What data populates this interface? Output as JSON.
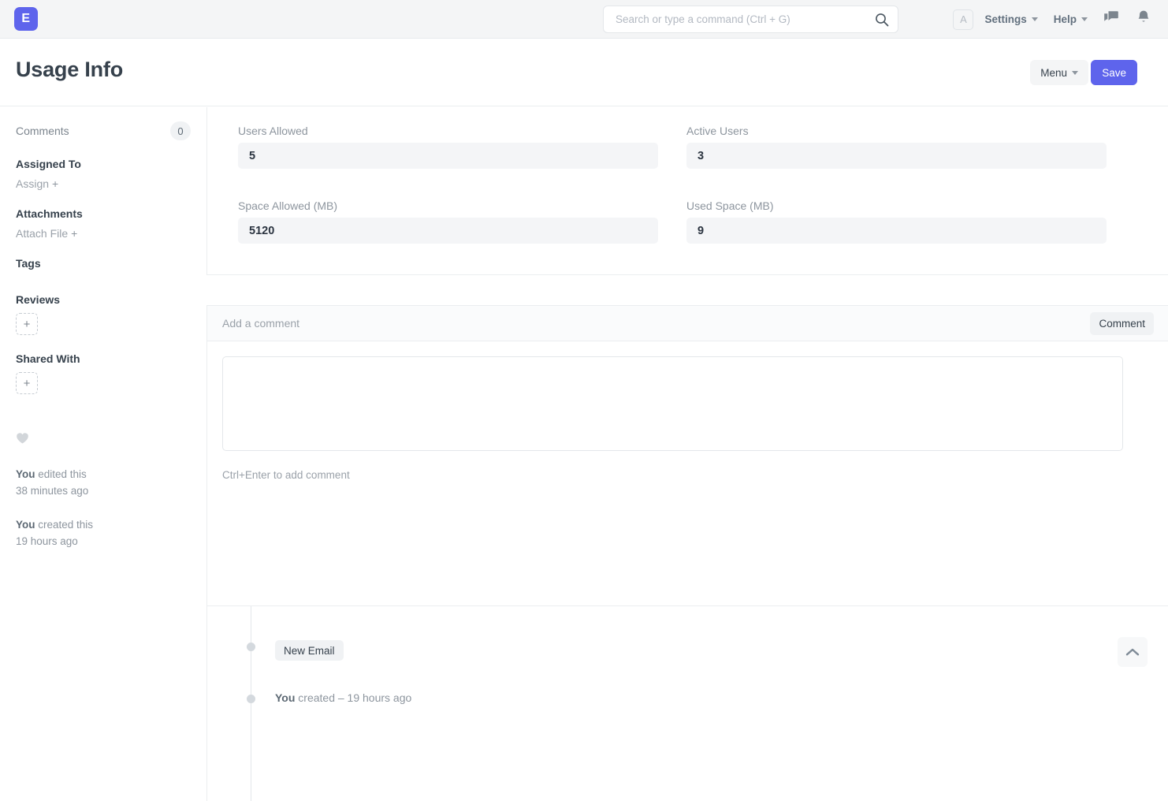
{
  "navbar": {
    "brand_letter": "E",
    "search_placeholder": "Search or type a command (Ctrl + G)",
    "search_value": "",
    "search_icon": "search-icon",
    "avatar_letter": "A",
    "settings_label": "Settings",
    "help_label": "Help",
    "chat_icon": "chat-icon",
    "notifications_icon": "bell-icon"
  },
  "page": {
    "title": "Usage Info",
    "menu_label": "Menu",
    "save_label": "Save"
  },
  "sidebar": {
    "comments_label": "Comments",
    "comments_count": "0",
    "assigned_to_label": "Assigned To",
    "assign_label": "Assign",
    "assign_plus": "+",
    "attachments_label": "Attachments",
    "attach_file_label": "Attach File",
    "attach_plus": "+",
    "tags_label": "Tags",
    "reviews_label": "Reviews",
    "reviews_add": "+",
    "shared_with_label": "Shared With",
    "shared_with_add": "+",
    "like_icon": "heart-icon",
    "edited_by": "You",
    "edited_text": " edited this",
    "edited_time": "38 minutes ago",
    "created_by": "You",
    "created_text": " created this",
    "created_time": "19 hours ago"
  },
  "form": {
    "fields": [
      {
        "label": "Users Allowed",
        "value": "5"
      },
      {
        "label": "Active Users",
        "value": "3"
      },
      {
        "label": "Space Allowed (MB)",
        "value": "5120"
      },
      {
        "label": "Used Space (MB)",
        "value": "9"
      }
    ]
  },
  "comment_section": {
    "header_title": "Add a comment",
    "button_label": "Comment",
    "textarea_value": "",
    "hint": "Ctrl+Enter to add comment"
  },
  "timeline": {
    "items": [
      {
        "type": "badge",
        "label": "New Email"
      },
      {
        "type": "text",
        "actor": "You",
        "label": " created – 19 hours ago"
      }
    ]
  },
  "footer": {
    "scroll_top_icon": "chevron-up-icon"
  },
  "colors": {
    "accent": "#5e64ec",
    "navbar_bg": "#f4f5f6",
    "field_bg": "#f4f5f7",
    "text": "#36414c",
    "muted": "#8d959e",
    "border": "#ebeef0"
  }
}
